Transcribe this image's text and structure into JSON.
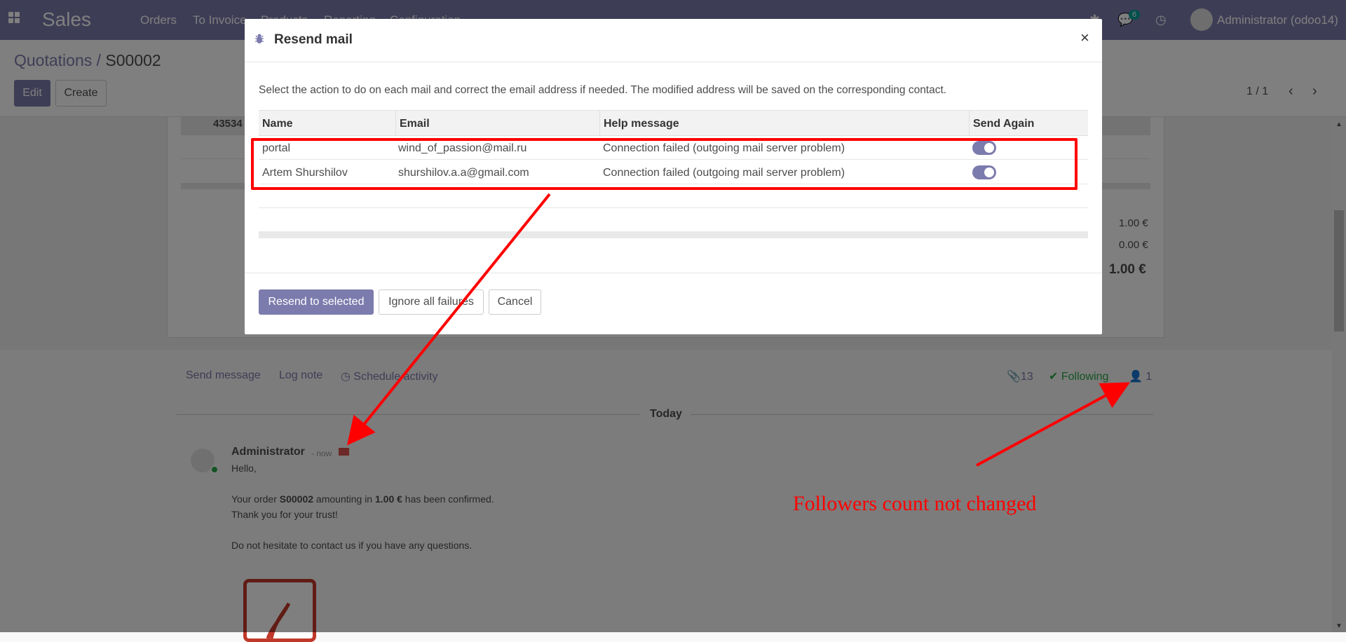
{
  "navbar": {
    "app_name": "Sales",
    "menu": [
      "Orders",
      "To Invoice",
      "Products",
      "Reporting",
      "Configuration"
    ],
    "message_count": "6",
    "user": "Administrator (odoo14)"
  },
  "control_panel": {
    "breadcrumb_parent": "Quotations",
    "breadcrumb_sep": " / ",
    "breadcrumb_current": "S00002",
    "edit_label": "Edit",
    "create_label": "Create",
    "pager": "1 / 1"
  },
  "sheet": {
    "partial_code": "43534",
    "untaxed": "1.00 €",
    "taxes": "0.00 €",
    "total": "1.00 €"
  },
  "chatter": {
    "send_message": "Send message",
    "log_note": "Log note",
    "schedule_activity": "Schedule activity",
    "attachments": "13",
    "following": "Following",
    "followers": "1",
    "date_separator": "Today",
    "message": {
      "author": "Administrator",
      "time": "- now",
      "lines": [
        "Hello,",
        "Thank you for your trust!",
        "Do not hesitate to contact us if you have any questions."
      ],
      "order_sentence": {
        "p1": "Your order ",
        "order": "S00002",
        "p2": " amounting in ",
        "amount": "1.00 €",
        "p3": " has been confirmed."
      }
    }
  },
  "modal": {
    "title": "Resend mail",
    "close": "×",
    "description": "Select the action to do on each mail and correct the email address if needed. The modified address will be saved on the corresponding contact.",
    "columns": [
      "Name",
      "Email",
      "Help message",
      "Send Again"
    ],
    "rows": [
      {
        "name": "portal",
        "email": "wind_of_passion@mail.ru",
        "help": "Connection failed (outgoing mail server problem)",
        "send_again": true
      },
      {
        "name": "Artem Shurshilov",
        "email": "shurshilov.a.a@gmail.com",
        "help": "Connection failed (outgoing mail server problem)",
        "send_again": true
      }
    ],
    "resend_label": "Resend to selected",
    "ignore_label": "Ignore all failures",
    "cancel_label": "Cancel"
  },
  "annotation": {
    "text": "Followers count not changed",
    "color": "#ff0000"
  },
  "colors": {
    "brand": "#7c7bad",
    "success": "#28a745",
    "annotation": "#ff0000"
  }
}
